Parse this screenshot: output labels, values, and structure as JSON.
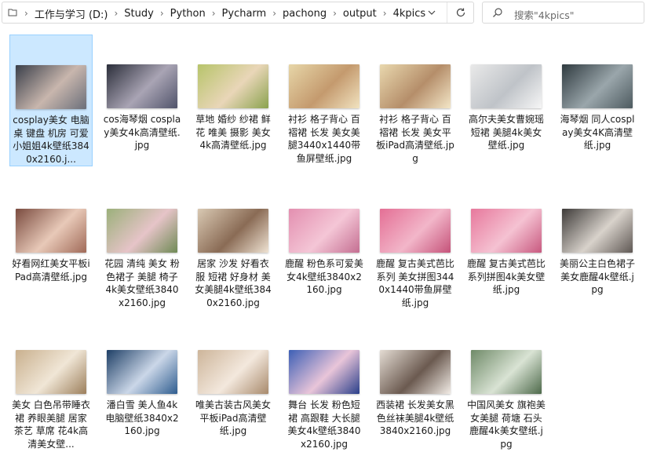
{
  "address_bar": {
    "breadcrumbs": [
      "工作与学习 (D:)",
      "Study",
      "Python",
      "Pycharm",
      "pachong",
      "output",
      "4kpics"
    ]
  },
  "search": {
    "placeholder": "搜索\"4kpics\""
  },
  "icons": {
    "location": "folder-location-icon",
    "chevron": "chevron-right-icon",
    "dropdown": "chevron-down-icon",
    "refresh": "refresh-icon",
    "search": "search-icon"
  },
  "files": [
    {
      "name": "cosplay美女 电脑桌 键盘 机房 可爱 小姐姐4k壁纸3840x2160.j...",
      "colors": [
        "#3a3f4a",
        "#c8b6ad",
        "#6b6f7a"
      ],
      "selected": true
    },
    {
      "name": "cos海琴烟 cosplay美女4k高清壁纸.jpg",
      "colors": [
        "#2b2e3a",
        "#a9a4b4",
        "#50536a"
      ]
    },
    {
      "name": "草地 婚纱 纱裙 鲜花 唯美 摄影 美女4k高清壁纸.jpg",
      "colors": [
        "#b7c46a",
        "#e9d6b8",
        "#8aa24e"
      ]
    },
    {
      "name": "衬衫 格子背心 百褶裙 长发 美女美腿3440x1440带鱼屏壁纸.jpg",
      "colors": [
        "#e7d6a8",
        "#c49a6e",
        "#f1e3c0"
      ]
    },
    {
      "name": "衬衫 格子背心 百褶裙 长发 美女平板iPad高清壁纸.jpg",
      "colors": [
        "#e9d8ae",
        "#b58e6a",
        "#f3e6c7"
      ]
    },
    {
      "name": "高尔夫美女曹婉瑶 短裙 美腿4k美女壁纸.jpg",
      "colors": [
        "#e9e9e9",
        "#bfc3c8",
        "#f6f6f6"
      ]
    },
    {
      "name": "海琴烟 同人cosplay美女4K高清壁纸.jpg",
      "colors": [
        "#2f3a3f",
        "#9aa6ab",
        "#4d5a5f"
      ]
    },
    {
      "name": "好看网红美女平板iPad高清壁纸.jpg",
      "colors": [
        "#7a4b3f",
        "#e8c9b8",
        "#a06a58"
      ]
    },
    {
      "name": "花园 清纯 美女 粉色裙子 美腿 椅子 4k美女壁纸3840x2160.jpg",
      "colors": [
        "#9bb07a",
        "#e6c4c8",
        "#6f8a55"
      ]
    },
    {
      "name": "居家 沙发 好看衣服 短裙 好身材 美女美腿4k壁纸3840x2160.jpg",
      "colors": [
        "#d9c9b3",
        "#8a6b55",
        "#efe3d3"
      ]
    },
    {
      "name": "鹿醒 粉色系可爱美女4k壁纸3840x2160.jpg",
      "colors": [
        "#e38fb0",
        "#f4c6d6",
        "#c46e91"
      ]
    },
    {
      "name": "鹿醒 复古美式芭比系列 美女拼图3440x1440带鱼屏壁纸.jpg",
      "colors": [
        "#e46f95",
        "#f2b6c9",
        "#c55279"
      ]
    },
    {
      "name": "鹿醒 复古美式芭比系列拼图4k美女壁纸.jpg",
      "colors": [
        "#e7789c",
        "#f5c2d2",
        "#c8597f"
      ]
    },
    {
      "name": "美丽公主白色裙子美女鹿醒4k壁纸.jpg",
      "colors": [
        "#3d3a38",
        "#d8d2cb",
        "#5e5753"
      ]
    },
    {
      "name": "美女 白色吊带睡衣裙 养眼美腿 居家 茶艺 草席 花4k高清美女壁...",
      "colors": [
        "#c9b08e",
        "#f0e6d6",
        "#9c7f5c"
      ]
    },
    {
      "name": "潘白雪 美人鱼4k电脑壁纸3840x2160.jpg",
      "colors": [
        "#1e3f66",
        "#cbd7e8",
        "#2f5d8f"
      ]
    },
    {
      "name": "唯美古装古风美女平板iPad高清壁纸.jpg",
      "colors": [
        "#cdb59a",
        "#f3e8dd",
        "#a88a6c"
      ]
    },
    {
      "name": "舞台 长发 粉色短裙 高跟鞋 大长腿美女4k壁纸3840x2160.jpg",
      "colors": [
        "#3d5fb5",
        "#e9c5d9",
        "#2a3f8a"
      ]
    },
    {
      "name": "西装裙 长发美女黑色丝袜美腿4k壁纸3840x2160.jpg",
      "colors": [
        "#e4dcd3",
        "#6b5a50",
        "#f2ece6"
      ]
    },
    {
      "name": "中国风美女 旗袍美女美腿 荷塘 石头 鹿醒4k美女壁纸.jpg",
      "colors": [
        "#6f8a68",
        "#d9e3d4",
        "#4e6a4b"
      ]
    }
  ]
}
